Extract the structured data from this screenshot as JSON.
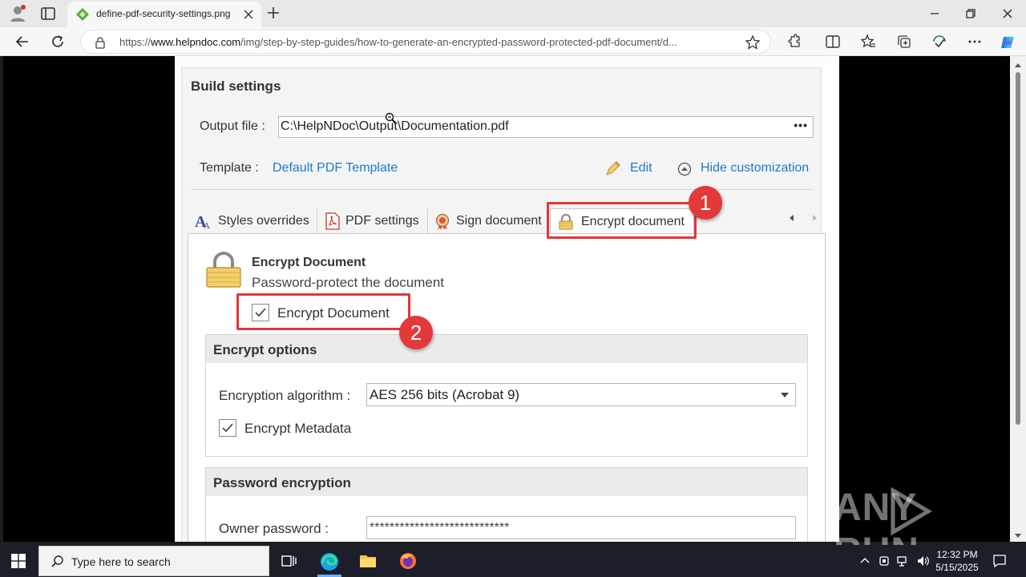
{
  "browser": {
    "tab_title": "define-pdf-security-settings.png",
    "url_prefix": "https://",
    "url_domain": "www.helpndoc.com",
    "url_path": "/img/step-by-step-guides/how-to-generate-an-encrypted-password-protected-pdf-document/d..."
  },
  "panel": {
    "title": "Build settings",
    "output_label": "Output file :",
    "output_value": "C:\\HelpNDoc\\Output\\Documentation.pdf",
    "output_browse": "•••",
    "template_label": "Template :",
    "template_value": "Default PDF Template",
    "edit_label": "Edit",
    "hide_label": "Hide customization",
    "tabs": [
      {
        "label": "Styles overrides"
      },
      {
        "label": "PDF settings"
      },
      {
        "label": "Sign document"
      },
      {
        "label": "Encrypt document"
      }
    ],
    "encrypt_heading": "Encrypt Document",
    "encrypt_sub": "Password-protect the document",
    "encrypt_checkbox": "Encrypt Document",
    "options_title": "Encrypt options",
    "algorithm_label": "Encryption algorithm :",
    "algorithm_value": "AES 256 bits (Acrobat 9)",
    "metadata_checkbox": "Encrypt Metadata",
    "password_title": "Password encryption",
    "owner_label": "Owner password :",
    "owner_value": "****************************"
  },
  "callouts": {
    "badge1": "1",
    "badge2": "2"
  },
  "watermark": {
    "left": "ANY",
    "right": "RUN"
  },
  "taskbar": {
    "search_placeholder": "Type here to search",
    "time": "12:32 PM",
    "date": "5/15/2025"
  },
  "colors": {
    "link": "#1e7bc8",
    "callout": "#e0363b",
    "taskbar": "#1c1f2a"
  }
}
